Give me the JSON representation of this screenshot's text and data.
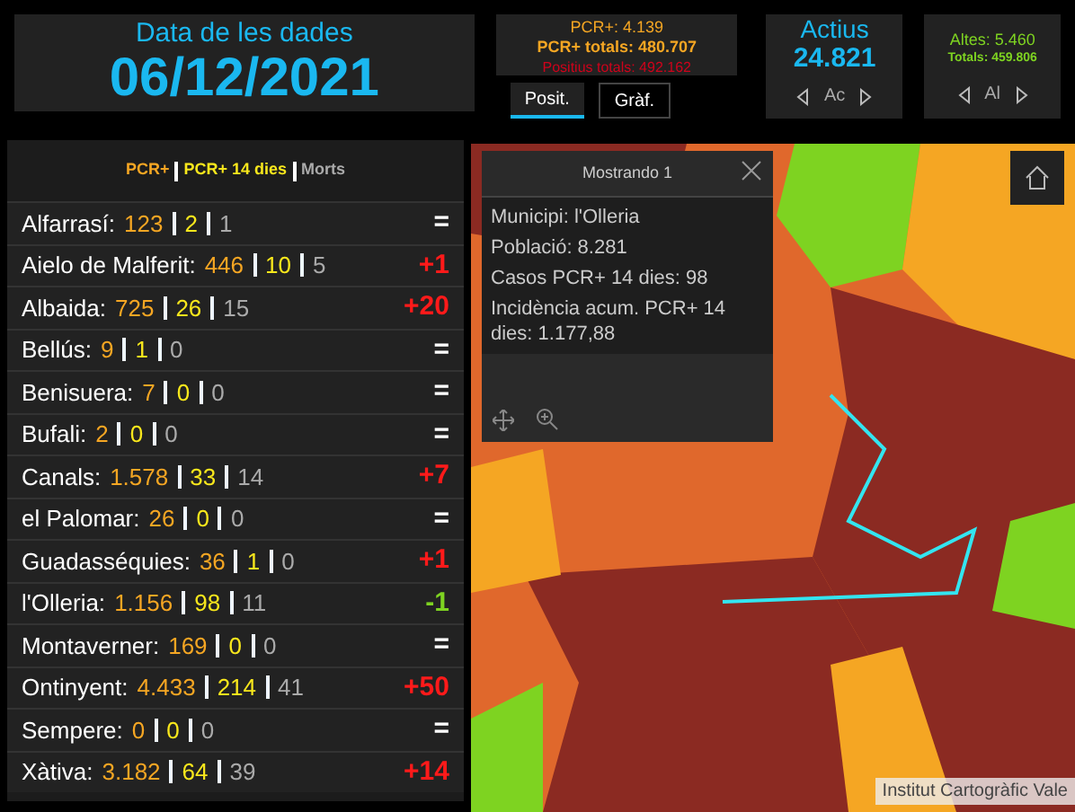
{
  "date_card": {
    "label": "Data de les dades",
    "value": "06/12/2021"
  },
  "pcr_card": {
    "pcr": "PCR+: 4.139",
    "pcr_total": "PCR+ totals: 480.707",
    "positius_total": "Positius totals: 492.162"
  },
  "pcr_tabs": [
    {
      "label": "Posit.",
      "selected": true
    },
    {
      "label": "Gràf.",
      "selected": false
    }
  ],
  "actius_card": {
    "title": "Actius",
    "value": "24.821",
    "pager": "Ac"
  },
  "altes_card": {
    "altes": "Altes: 5.460",
    "totals": "Totals: 459.806",
    "pager": "Al"
  },
  "legend": {
    "pcr": "PCR+",
    "pcr14": "PCR+ 14 dies",
    "morts": "Morts"
  },
  "rows": [
    {
      "name": "Alfarrasí:",
      "pcr": "123",
      "pcr14": "2",
      "morts": "1",
      "change": "=",
      "color": "#ffffff"
    },
    {
      "name": "Aielo de Malferit:",
      "pcr": "446",
      "pcr14": "10",
      "morts": "5",
      "change": "+1",
      "color": "#ff1a1a"
    },
    {
      "name": "Albaida:",
      "pcr": "725",
      "pcr14": "26",
      "morts": "15",
      "change": "+20",
      "color": "#ff1a1a"
    },
    {
      "name": "Bellús:",
      "pcr": "9",
      "pcr14": "1",
      "morts": "0",
      "change": "=",
      "color": "#ffffff"
    },
    {
      "name": "Benisuera:",
      "pcr": "7",
      "pcr14": "0",
      "morts": "0",
      "change": "=",
      "color": "#ffffff"
    },
    {
      "name": "Bufali:",
      "pcr": "2",
      "pcr14": "0",
      "morts": "0",
      "change": "=",
      "color": "#ffffff"
    },
    {
      "name": "Canals:",
      "pcr": "1.578",
      "pcr14": "33",
      "morts": "14",
      "change": "+7",
      "color": "#ff1a1a"
    },
    {
      "name": "el Palomar:",
      "pcr": "26",
      "pcr14": "0",
      "morts": "0",
      "change": "=",
      "color": "#ffffff"
    },
    {
      "name": "Guadasséquies:",
      "pcr": "36",
      "pcr14": "1",
      "morts": "0",
      "change": "+1",
      "color": "#ff1a1a"
    },
    {
      "name": "l'Olleria:",
      "pcr": "1.156",
      "pcr14": "98",
      "morts": "11",
      "change": "-1",
      "color": "#7ed321"
    },
    {
      "name": "Montaverner:",
      "pcr": "169",
      "pcr14": "0",
      "morts": "0",
      "change": "=",
      "color": "#ffffff"
    },
    {
      "name": "Ontinyent:",
      "pcr": "4.433",
      "pcr14": "214",
      "morts": "41",
      "change": "+50",
      "color": "#ff1a1a"
    },
    {
      "name": "Sempere:",
      "pcr": "0",
      "pcr14": "0",
      "morts": "0",
      "change": "=",
      "color": "#ffffff"
    },
    {
      "name": "Xàtiva:",
      "pcr": "3.182",
      "pcr14": "64",
      "morts": "39",
      "change": "+14",
      "color": "#ff1a1a"
    }
  ],
  "popup": {
    "title": "Mostrando 1",
    "lines": [
      "Municipi: l'Olleria",
      "Població: 8.281",
      "Casos PCR+ 14 dies: 98",
      "Incidència acum. PCR+ 14 dies: 1.177,88"
    ]
  },
  "attribution": "Institut Cartogràfic Vale"
}
